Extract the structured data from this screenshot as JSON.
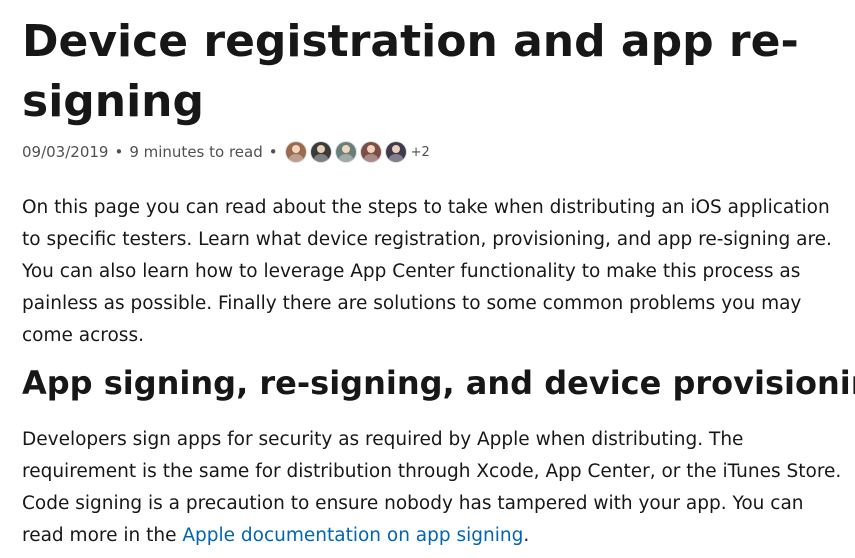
{
  "article": {
    "title": "Device registration and app re-signing",
    "date": "09/03/2019",
    "read_time": "9 minutes to read",
    "separator": "•",
    "contributors": [
      {
        "icon": "contributor-avatar",
        "color": "#9a6b4f"
      },
      {
        "icon": "contributor-avatar",
        "color": "#3b3b3b"
      },
      {
        "icon": "contributor-avatar",
        "color": "#6b7f7a"
      },
      {
        "icon": "contributor-avatar",
        "color": "#7a4e46"
      },
      {
        "icon": "contributor-avatar",
        "color": "#3f3a4d"
      }
    ],
    "contributors_more": "+2",
    "intro": "On this page you can read about the steps to take when distributing an iOS application to specific testers. Learn what device registration, provisioning, and app re-signing are. You can also learn how to leverage App Center functionality to make this process as painless as possible. Finally there are solutions to some common problems you may come across.",
    "section_heading": "App signing, re-signing, and device provisioning",
    "section_text": "Developers sign apps for security as required by Apple when distributing. The requirement is the same for distribution through Xcode, App Center, or the iTunes Store. Code signing is a precaution to ensure nobody has tampered with your app. You can read more in the ",
    "section_link": "Apple documentation on app signing",
    "section_end": "."
  },
  "colors": {
    "text": "#171717",
    "meta": "#505050",
    "link": "#0065b3"
  }
}
